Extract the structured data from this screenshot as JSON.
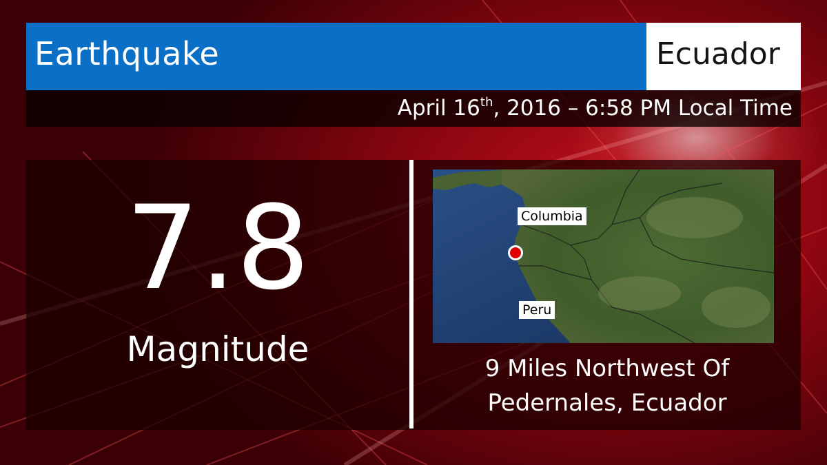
{
  "header": {
    "title": "Earthquake",
    "country": "Ecuador"
  },
  "date": {
    "prefix": "April 16",
    "ordinal_suffix": "th",
    "rest": ", 2016 – 6:58 PM Local Time"
  },
  "magnitude": {
    "value": "7.8",
    "label": "Magnitude"
  },
  "map": {
    "labels": {
      "columbia": "Columbia",
      "peru": "Peru"
    },
    "marker_color": "#e00000"
  },
  "location": {
    "line1": "9 Miles Northwest Of",
    "line2": "Pedernales, Ecuador"
  },
  "colors": {
    "title_bar": "#0a6fc6",
    "background": "#8a0610"
  }
}
